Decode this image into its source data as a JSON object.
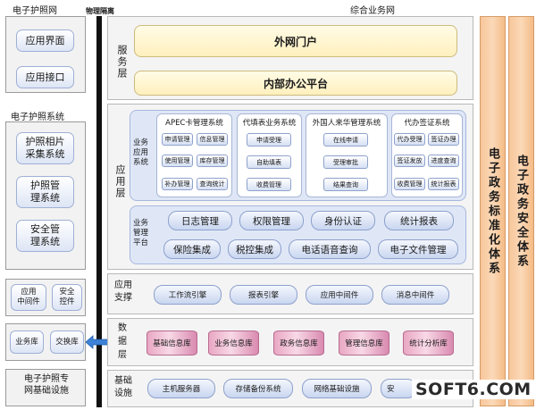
{
  "headers": {
    "left": "电子护照网",
    "divider": "物理隔离",
    "center": "综合业务网"
  },
  "left_panel": {
    "top_items": [
      "应用界面",
      "应用接口"
    ],
    "system_title": "电子护照系统",
    "system_items": [
      "护照相片\n采集系统",
      "护照管\n理系统",
      "安全管\n理系统"
    ],
    "middleware": [
      "应用\n中间件",
      "安全\n控件"
    ],
    "databases": [
      "业务库",
      "交换库"
    ],
    "infra": "电子护照专\n网基础设施"
  },
  "service_layer": {
    "label": "服务层",
    "items": [
      "外网门户",
      "内部办公平台"
    ]
  },
  "app_layer": {
    "label": "应用层",
    "biz_app_label": "业务\n应用\n系统",
    "systems": [
      {
        "title": "APEC卡管理系统",
        "items": [
          "申请管理",
          "信息管理",
          "使用管理",
          "库存管理",
          "补办管理",
          "查询统计"
        ]
      },
      {
        "title": "代填表业务系统",
        "items": [
          "申请受理",
          "自助填表",
          "收费管理"
        ]
      },
      {
        "title": "外国人来华管理系统",
        "items": [
          "在线申请",
          "受理审批",
          "结果查询"
        ]
      },
      {
        "title": "代办签证系统",
        "items": [
          "代办受理",
          "签证办理",
          "签证发放",
          "进度查询",
          "收费管理",
          "统计报表"
        ]
      }
    ],
    "biz_mgmt_label": "业务\n管理\n平台",
    "mgmt_row1": [
      "日志管理",
      "权限管理",
      "身份认证",
      "统计报表"
    ],
    "mgmt_row2": [
      "保险集成",
      "税控集成",
      "电话语音查询",
      "电子文件管理"
    ]
  },
  "support_layer": {
    "label": "应用\n支撑",
    "items": [
      "工作流引擎",
      "报表引擎",
      "应用中间件",
      "消息中间件"
    ]
  },
  "data_layer": {
    "label": "数\n据\n层",
    "items": [
      "基础信息库",
      "业务信息库",
      "政务信息库",
      "管理信息库",
      "统计分析库"
    ]
  },
  "infra_layer": {
    "label": "基础\n设施",
    "items": [
      "主机服务器",
      "存储备份系统",
      "网络基础设施",
      "安"
    ]
  },
  "side_columns": [
    "电子政务标准化体系",
    "电子政务安全体系"
  ],
  "watermark": "SOFT6.COM"
}
